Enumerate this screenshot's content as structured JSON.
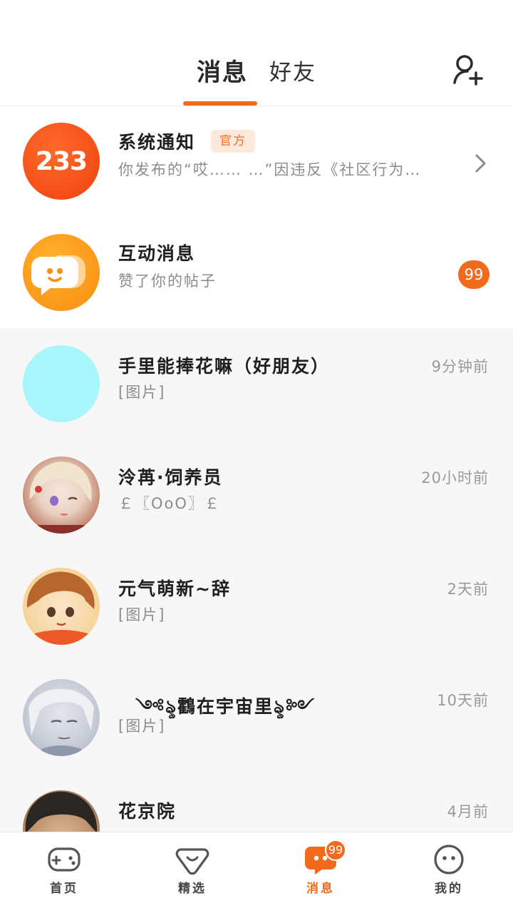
{
  "header": {
    "tabs": [
      {
        "label": "消息",
        "active": true
      },
      {
        "label": "好友",
        "active": false
      }
    ],
    "add_friend_icon": "add-user-icon",
    "accent_color": "#f26b1d"
  },
  "pinned": [
    {
      "avatar_text": "233",
      "name": "系统通知",
      "tag": "官方",
      "preview": "你发布的“哎……  …”因违反《社区行为…",
      "trailing_icon": "chevron-right-icon"
    },
    {
      "avatar_icon": "chat-bubble-icon",
      "name": "互动消息",
      "preview": "赞了你的帖子",
      "badge": "99"
    }
  ],
  "conversations": [
    {
      "name": "手里能捧花嘛（好朋友）",
      "preview": "[图片]",
      "time": "9分钟前"
    },
    {
      "name": "泠苒·饲养员",
      "preview": "￡〖OoO〗￡",
      "time": "20小时前"
    },
    {
      "name": "元气萌新~辞",
      "preview": "[图片]",
      "time": "2天前"
    },
    {
      "name": "༺ৡ鸖在宇宙里ৡ༻",
      "preview": "[图片]",
      "time": "10天前"
    },
    {
      "name": "花京院",
      "preview": "",
      "time": "4月前"
    }
  ],
  "bottom_nav": [
    {
      "label": "首页",
      "icon": "gamepad-icon",
      "active": false
    },
    {
      "label": "精选",
      "icon": "heart-bubble-icon",
      "active": false
    },
    {
      "label": "消息",
      "icon": "message-icon",
      "active": true,
      "badge": "99"
    },
    {
      "label": "我的",
      "icon": "smiley-face-icon",
      "active": false
    }
  ]
}
